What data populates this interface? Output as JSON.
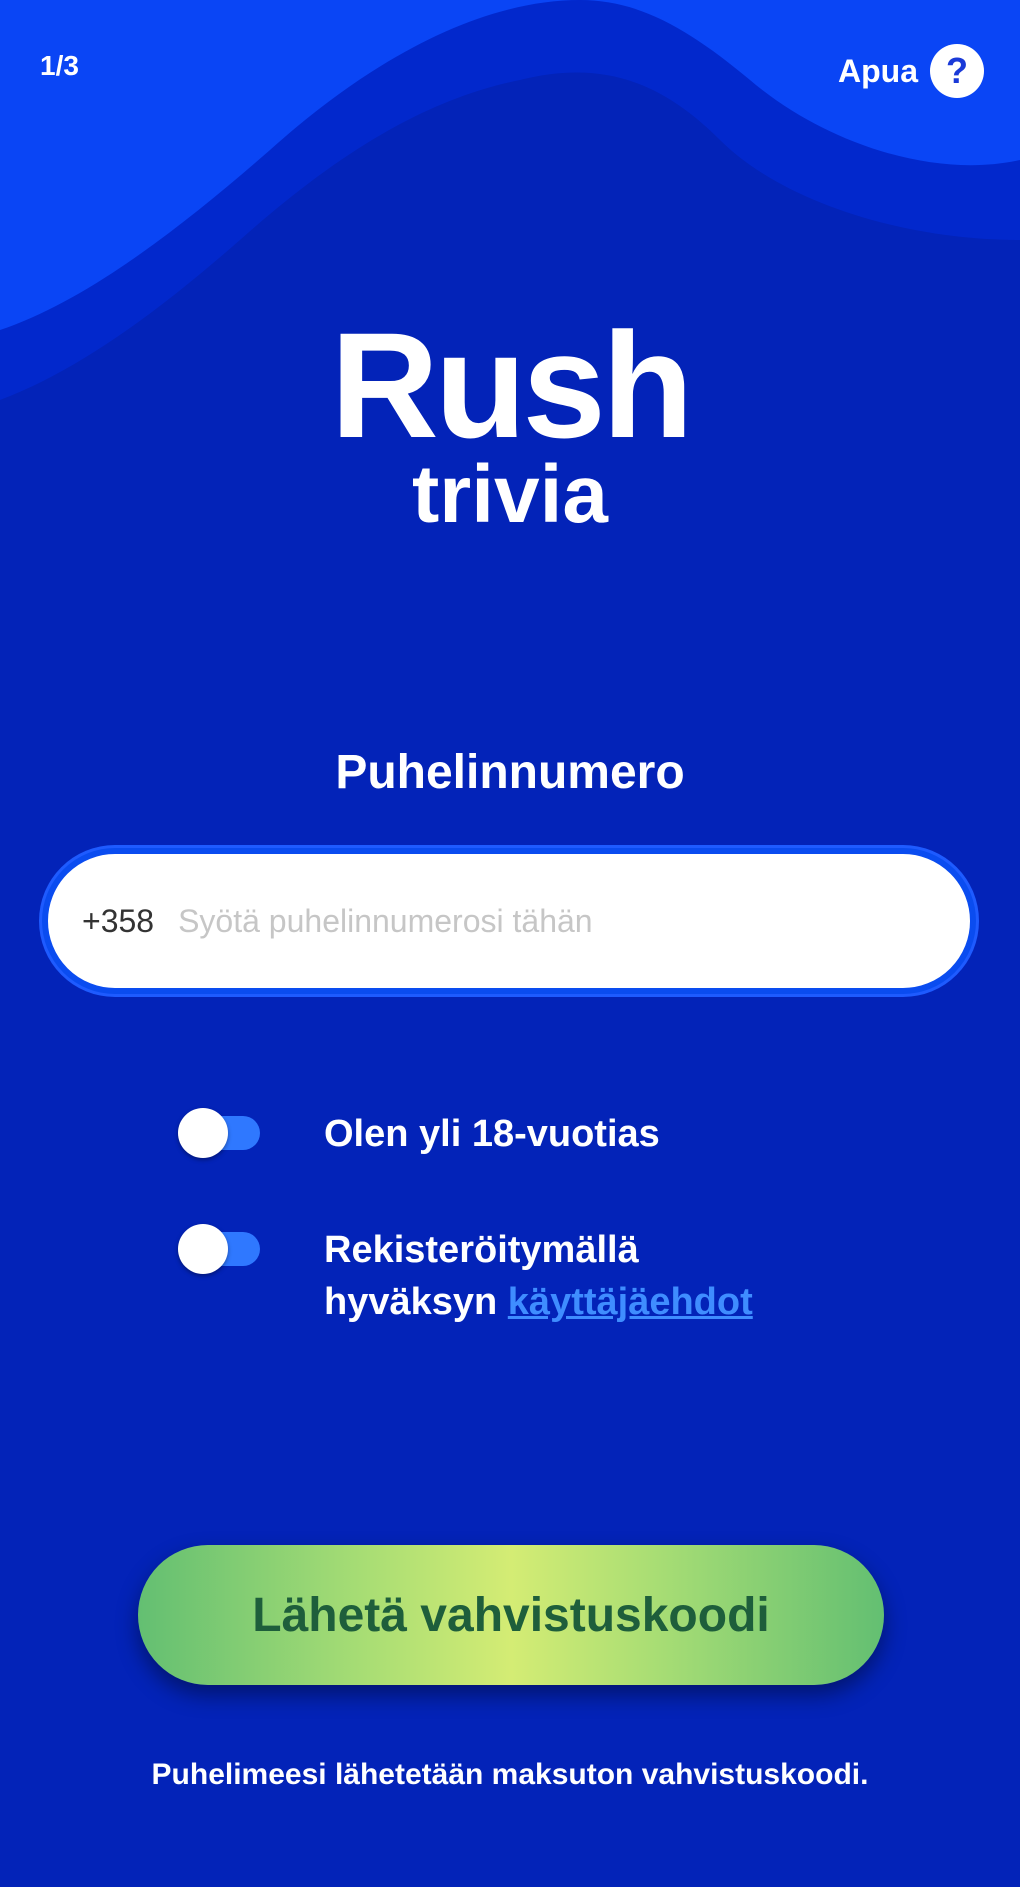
{
  "header": {
    "step": "1/3",
    "help_label": "Apua",
    "help_icon": "question-icon"
  },
  "logo": {
    "line1": "Rush",
    "line2": "trivia"
  },
  "phone": {
    "label": "Puhelinnumero",
    "prefix": "+358",
    "value": "",
    "placeholder": "Syötä puhelinnumerosi tähän"
  },
  "toggles": {
    "age": {
      "label": "Olen yli 18-vuotias",
      "on": false
    },
    "terms": {
      "line1": "Rekisteröitymällä",
      "line2_prefix": "hyväksyn",
      "link": "käyttäjäehdot",
      "on": false
    }
  },
  "submit_label": "Lähetä vahvistuskoodi",
  "footer_note": "Puhelimeesi lähetetään maksuton vahvistuskoodi.",
  "colors": {
    "background": "#0323b8",
    "wave_light": "#0a45f5",
    "toggle_track": "#2f78ff",
    "link": "#3f8dff",
    "button_text": "#1e5e3b"
  }
}
